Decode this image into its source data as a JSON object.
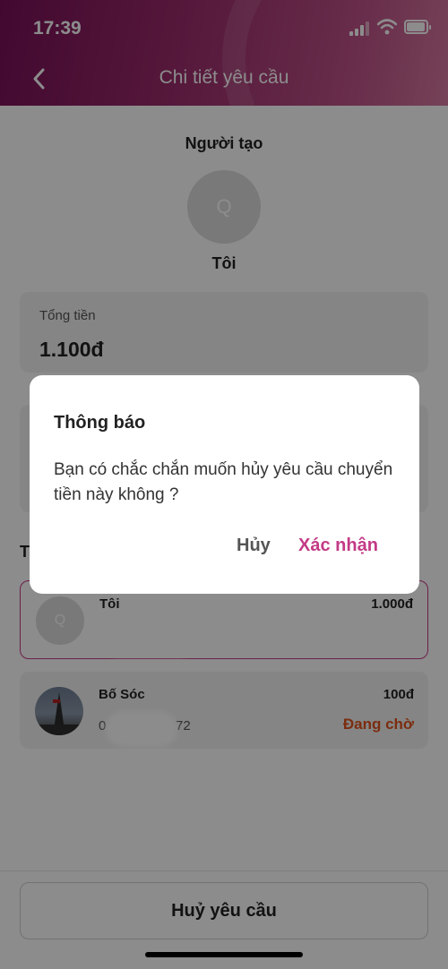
{
  "status_bar": {
    "time": "17:39"
  },
  "nav": {
    "title": "Chi tiết yêu cầu",
    "back_icon": "chevron-left-icon"
  },
  "creator": {
    "label": "Người tạo",
    "avatar_initial": "Q",
    "name": "Tôi"
  },
  "total": {
    "label": "Tổng tiền",
    "value": "1.100đ"
  },
  "section": {
    "title": "T"
  },
  "members": [
    {
      "name": "Tôi",
      "avatar_initial": "Q",
      "amount": "1.000đ",
      "phone": "",
      "status": ""
    },
    {
      "name": "Bố Sóc",
      "avatar_initial": "",
      "amount": "100đ",
      "phone_start": "0",
      "phone_end": "72",
      "status": "Đang chờ"
    }
  ],
  "footer": {
    "cancel_request_label": "Huỷ yêu cầu"
  },
  "dialog": {
    "title": "Thông báo",
    "message": "Bạn có chắc chắn muốn hủy yêu cầu chuyển tiền này không ?",
    "cancel_label": "Hủy",
    "confirm_label": "Xác nhận"
  },
  "colors": {
    "accent": "#c33a86",
    "header": "#7a1058",
    "status_pending": "#e0531c"
  }
}
